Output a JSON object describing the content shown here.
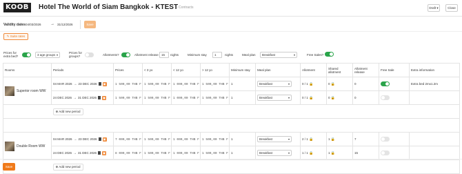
{
  "header": {
    "logo": "KOOB",
    "title": "Hotel The World of Siam Bangkok - KTEST",
    "crumb": "› Contracts",
    "draft_label": "Draft ▾",
    "close_label": "Close"
  },
  "validity": {
    "label": "Validity dates",
    "from": "04/03/2026",
    "to": "31/12/2026",
    "save_label": "Save"
  },
  "suite_rates_label": "Suite rates",
  "options": {
    "prices_extra_bed_label": "Prices for extra bed?",
    "age_groups_label": "3 age groups",
    "prices_groups_label": "Prices for groups?",
    "allotments_label": "Allotments?",
    "allotment_release_label": "Allotment release",
    "allotment_release_value": "15",
    "nights_label": "nights",
    "minimum_stay_label": "Minimum stay",
    "minimum_stay_value": "1",
    "nights2_label": "nights",
    "meal_plan_label": "Meal plan",
    "meal_plan_value": "Breakfast",
    "free_sales_label": "Free Sales?"
  },
  "table": {
    "headers": [
      "Rooms",
      "Periods",
      "Prices",
      "< 3 yo",
      "< 12 yo",
      "> 12 yo",
      "Minimum stay",
      "Meal plan",
      "Allotment",
      "Shared allotment",
      "Allotment release",
      "Free Sale",
      "Extra information"
    ],
    "add_period_label": "Add new period",
    "rooms": [
      {
        "name": "Superior room WW",
        "rows": [
          {
            "from": "04 MAR 2026",
            "to": "23 DEC 2026",
            "price": "1 500,00 THB F",
            "lt3": "1 500,00 THB F",
            "lt12": "1 000,00 THB F",
            "gt12": "1 500,00 THB F",
            "min_stay": "1",
            "meal": "Breakfast",
            "allotment": "0 / 1",
            "shared": "0",
            "release": "0",
            "extra": "Extra bed 2mx1.2m"
          },
          {
            "from": "24 DEC 2026",
            "to": "31 DEC 2026",
            "price": "1 500,00 THB F",
            "lt3": "1 500,00 THB F",
            "lt12": "1 000,00 THB F",
            "gt12": "1 500,00 THB F",
            "min_stay": "1",
            "meal": "Breakfast",
            "allotment": "0 / 1",
            "shared": "0",
            "release": "0",
            "extra": ""
          }
        ]
      },
      {
        "name": "Double Room WW",
        "rows": [
          {
            "from": "04 MAR 2026",
            "to": "23 DEC 2026",
            "price": "7 000,00 THB F",
            "lt3": "1 500,00 THB F",
            "lt12": "1 000,00 THB F",
            "gt12": "1 500,00 THB F",
            "min_stay": "1",
            "meal": "Breakfast",
            "allotment": "2 / 1",
            "shared": "1",
            "release": "7",
            "extra": ""
          },
          {
            "from": "24 DEC 2026",
            "to": "31 DEC 2026",
            "price": "8 000,00 THB F",
            "lt3": "1 500,00 THB F",
            "lt12": "1 000,00 THB F",
            "gt12": "1 500,00 THB F",
            "min_stay": "1",
            "meal": "Breakfast",
            "allotment": "1 / 1",
            "shared": "1",
            "release": "15",
            "extra": ""
          }
        ]
      }
    ]
  },
  "footer": {
    "save_label": "Save"
  },
  "colors": {
    "accent": "#f07a1a",
    "toggle_on": "#2aa44a"
  }
}
